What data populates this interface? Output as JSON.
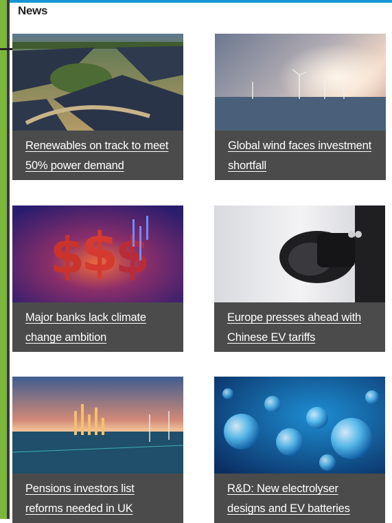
{
  "section": {
    "title": "News"
  },
  "colors": {
    "accent_green": "#7bb73a",
    "accent_blue": "#1596d6",
    "caption_bg": "#4b4b4b"
  },
  "cards": [
    {
      "title": "Renewables on track to meet 50% power demand",
      "image": "solar-farm-aerial"
    },
    {
      "title": "Global wind faces investment shortfall",
      "image": "offshore-wind-sunset"
    },
    {
      "title": "Major banks lack climate change ambition",
      "image": "dollar-signs-finance"
    },
    {
      "title": "Europe presses ahead with Chinese EV tariffs",
      "image": "ev-charging-plug"
    },
    {
      "title": "Pensions investors list reforms needed in UK",
      "image": "city-wind-chart"
    },
    {
      "title": "R&D: New electrolyser designs and EV batteries",
      "image": "blue-bubbles"
    }
  ]
}
